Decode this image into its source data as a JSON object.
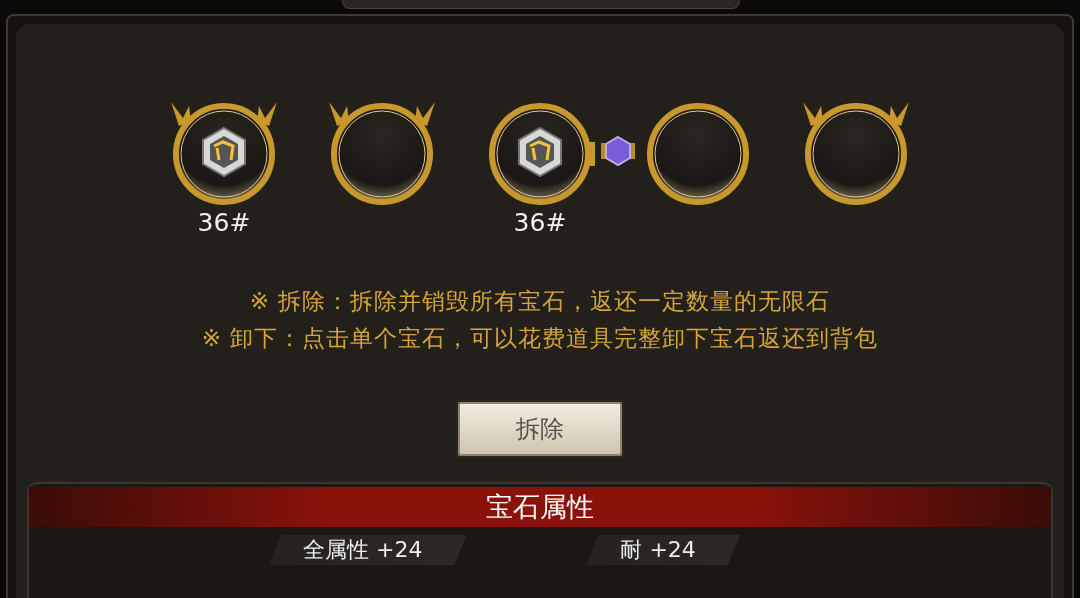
{
  "sockets": [
    {
      "horns": true,
      "gem": true,
      "label": "36#",
      "linked_next": false
    },
    {
      "horns": true,
      "gem": false,
      "linked_next": false
    },
    {
      "horns": false,
      "gem": true,
      "label": "36#",
      "linked_next": true
    },
    {
      "horns": false,
      "gem": false,
      "linked_next": false
    },
    {
      "horns": true,
      "gem": false,
      "linked_next": false
    }
  ],
  "notes": [
    "※  拆除：拆除并销毁所有宝石，返还一定数量的无限石",
    "※  卸下：点击单个宝石，可以花费道具完整卸下宝石返还到背包"
  ],
  "remove_button": "拆除",
  "attributes": {
    "title": "宝石属性",
    "stats": [
      "全属性  +24",
      "耐  +24"
    ]
  }
}
